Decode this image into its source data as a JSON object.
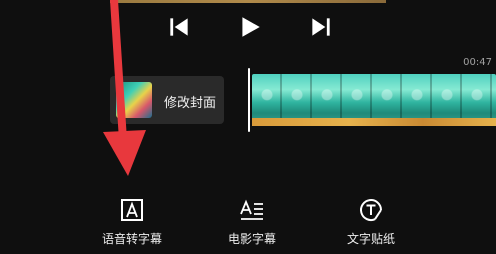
{
  "player": {
    "controls": [
      {
        "name": "previous-frame-button",
        "icon": "skip-previous-icon"
      },
      {
        "name": "play-button",
        "icon": "play-icon"
      },
      {
        "name": "next-frame-button",
        "icon": "skip-next-icon"
      }
    ]
  },
  "timeline": {
    "time": "00:47",
    "cover_label": "修改封面"
  },
  "toolbar": {
    "items": [
      {
        "label": "语音转字幕",
        "icon": "text-box-a-icon"
      },
      {
        "label": "电影字幕",
        "icon": "movie-subtitle-icon"
      },
      {
        "label": "文字贴纸",
        "icon": "text-sticker-icon"
      }
    ]
  },
  "colors": {
    "background": "#0f0f0f",
    "annotation_arrow": "#e8383d",
    "playhead": "#ffffff"
  }
}
